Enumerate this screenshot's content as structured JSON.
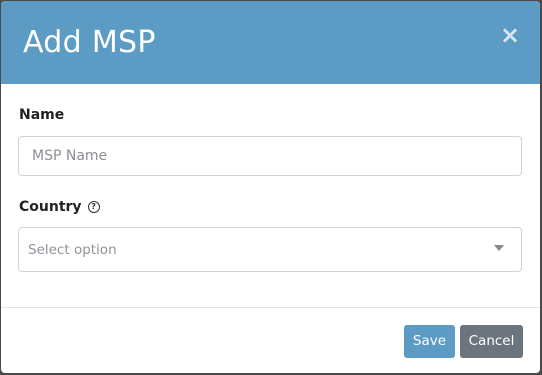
{
  "modal": {
    "title": "Add MSP",
    "close_label": "×"
  },
  "form": {
    "name": {
      "label": "Name",
      "value": "",
      "placeholder": "MSP Name"
    },
    "country": {
      "label": "Country",
      "help_icon": "question-circle-icon",
      "help_glyph": "?",
      "selected": "Select option"
    }
  },
  "footer": {
    "save_label": "Save",
    "cancel_label": "Cancel"
  },
  "colors": {
    "header": "#5b9bc4",
    "save_button": "#5b9bc4",
    "cancel_button": "#6c757d"
  }
}
